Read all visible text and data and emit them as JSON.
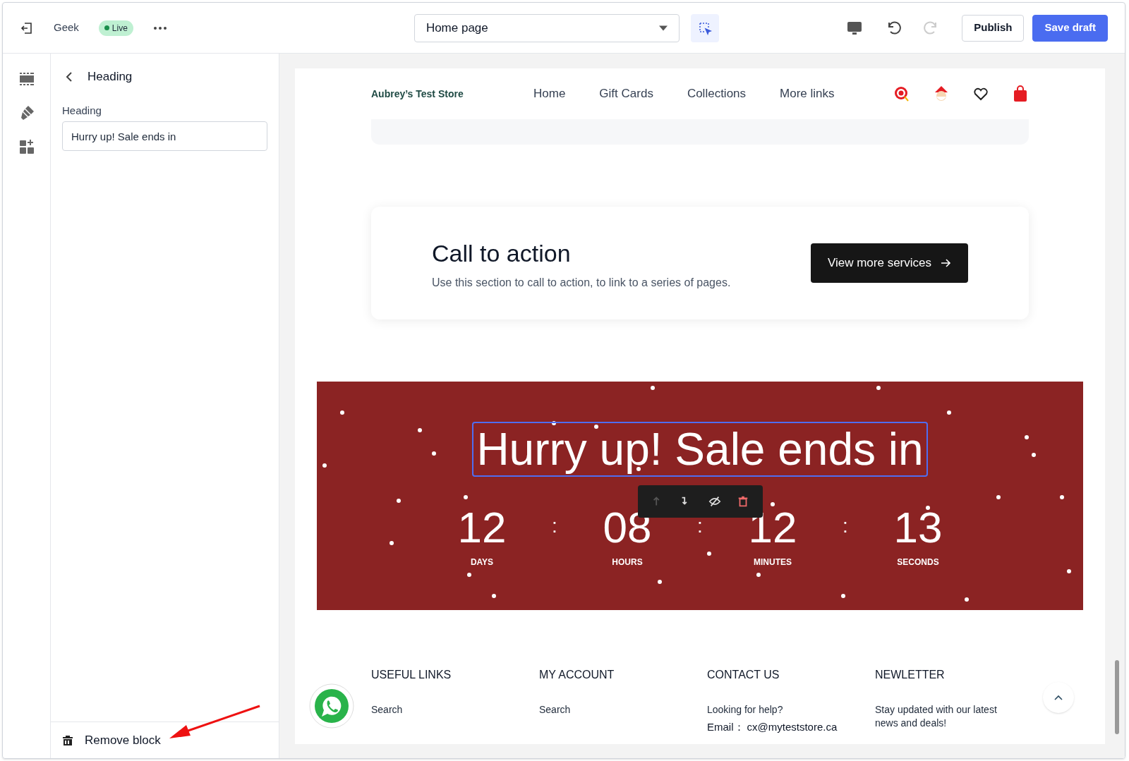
{
  "topbar": {
    "theme_name": "Geek",
    "status": "Live",
    "page_select": "Home page",
    "inspector_selected": true,
    "redo_disabled": true,
    "buttons": [
      {
        "label": "Publish",
        "kind": "secondary"
      },
      {
        "label": "Save draft",
        "kind": "primary"
      }
    ]
  },
  "panel": {
    "title": "Heading",
    "field_label": "Heading",
    "field_value": "Hurry up! Sale ends in",
    "remove_label": "Remove block"
  },
  "preview": {
    "store_name": "Aubrey’s Test Store",
    "nav": [
      "Home",
      "Gift Cards",
      "Collections",
      "More links"
    ],
    "cta": {
      "title": "Call to action",
      "text": "Use this section to call to action, to link to a series of pages.",
      "button": "View more services"
    },
    "countdown": {
      "heading": "Hurry up! Sale ends in",
      "separator": ":",
      "units": [
        {
          "value": "12",
          "label": "DAYS"
        },
        {
          "value": "08",
          "label": "HOURS"
        },
        {
          "value": "12",
          "label": "MINUTES"
        },
        {
          "value": "13",
          "label": "SECONDS"
        }
      ],
      "tools": [
        {
          "kind": "up",
          "disabled": true
        },
        {
          "kind": "down",
          "disabled": false
        },
        {
          "kind": "hide",
          "disabled": false
        },
        {
          "kind": "delete",
          "disabled": false
        }
      ]
    },
    "footer": [
      {
        "title": "USEFUL LINKS",
        "lines": [
          "Search"
        ]
      },
      {
        "title": "MY ACCOUNT",
        "lines": [
          "Search"
        ]
      },
      {
        "title": "CONTACT US",
        "lines": [
          "Looking for help?"
        ],
        "email_label": "Email：",
        "email": "cx@myteststore.ca"
      },
      {
        "title": "NEWLETTER",
        "lines": [
          "Stay updated with our latest news and deals!"
        ]
      }
    ]
  }
}
